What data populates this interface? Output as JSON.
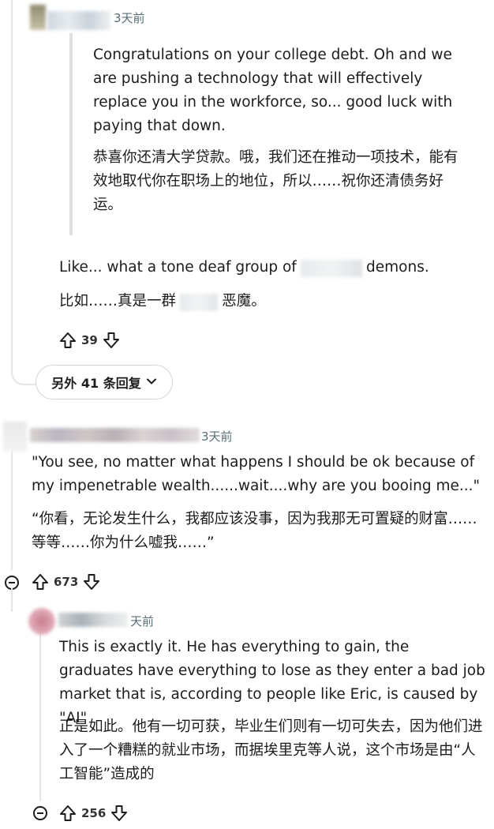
{
  "comment1": {
    "time": "3天前",
    "quote_en": "Congratulations on your college debt. Oh and we are pushing a technology that will effectively replace you in the workforce, so... good luck with paying that down.",
    "quote_zh": "恭喜你还清大学贷款。哦，我们还在推动一项技术，能有效地取代你在职场上的地位，所以……祝你还清债务好运。",
    "body_en_before": "Like... what a tone deaf group of",
    "body_en_after": "demons.",
    "body_zh_before": "比如……真是一群",
    "body_zh_after": "恶魔。",
    "votes": "39"
  },
  "more_replies": {
    "label": "另外 41 条回复"
  },
  "comment2": {
    "time": "3天前",
    "body_en": "\"You see, no matter what happens I should be ok because of my impenetrable wealth......wait....why are you booing me...\"",
    "body_zh": "“你看，无论发生什么，我都应该没事，因为我那无可置疑的财富……等等……你为什么嘘我……”",
    "votes": "673"
  },
  "comment3": {
    "time": "天前",
    "body_en": "This is exactly it. He has everything to gain, the graduates have everything to lose as they enter a bad job market that is, according to people like Eric, is caused by \"AI\"",
    "body_zh": "正是如此。他有一切可获，毕业生们则有一切可失去，因为他们进入了一个糟糕的就业市场，而据埃里克等人说，这个市场是由“人工智能”造成的",
    "votes": "256"
  },
  "colors": {
    "accent": "#1c1c1c",
    "meta": "#576f76",
    "thread_line": "#e3e6e8"
  }
}
